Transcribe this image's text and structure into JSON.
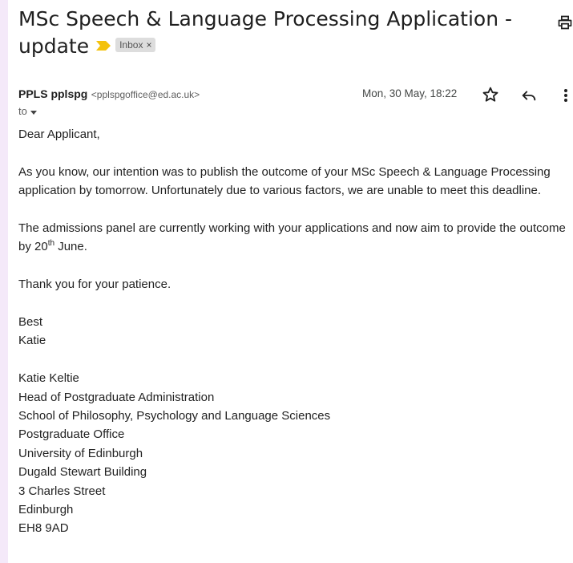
{
  "email": {
    "subject": "MSc Speech & Language Processing Application - update",
    "label": "Inbox",
    "label_close": "×",
    "sender_name": "PPLS pplspg",
    "sender_email": "<pplspgoffice@ed.ac.uk>",
    "date": "Mon, 30 May, 18:22",
    "to": "to",
    "colors": {
      "importance_marker": "#f4c20d",
      "left_strip": "#f4e9f9"
    }
  },
  "body": {
    "greeting": "Dear Applicant,",
    "para1": "As you know, our intention was to publish the outcome of your MSc Speech & Language Processing application by tomorrow.  Unfortunately due to various factors, we are unable to meet this deadline.",
    "para2_before": "The admissions panel are currently working with your applications and now aim to provide the outcome by 20",
    "para2_sup": "th",
    "para2_after": " June.",
    "para3": "Thank you for your patience.",
    "closing": "Best",
    "closing_name": "Katie",
    "signature": [
      "Katie Keltie",
      "Head of Postgraduate Administration",
      "School of Philosophy, Psychology and Language Sciences",
      "Postgraduate Office",
      "University of Edinburgh",
      "Dugald Stewart Building",
      "3 Charles Street",
      "Edinburgh",
      "EH8 9AD"
    ]
  }
}
